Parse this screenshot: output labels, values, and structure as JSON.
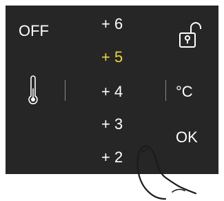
{
  "power": {
    "label": "OFF"
  },
  "levels": {
    "items": [
      "+ 6",
      "+ 5",
      "+ 4",
      "+ 3",
      "+ 2"
    ],
    "selected": "+ 5"
  },
  "unit": {
    "label": "°C"
  },
  "confirm": {
    "label": "OK"
  },
  "icons": {
    "temperature": "thermometer-icon",
    "lock": "unlocked-padlock-icon",
    "gesture": "finger-swipe-icon"
  },
  "colors": {
    "panel": "#262626",
    "text": "#ffffff",
    "selected": "#f2d33a",
    "divider": "#8a8a8a"
  }
}
